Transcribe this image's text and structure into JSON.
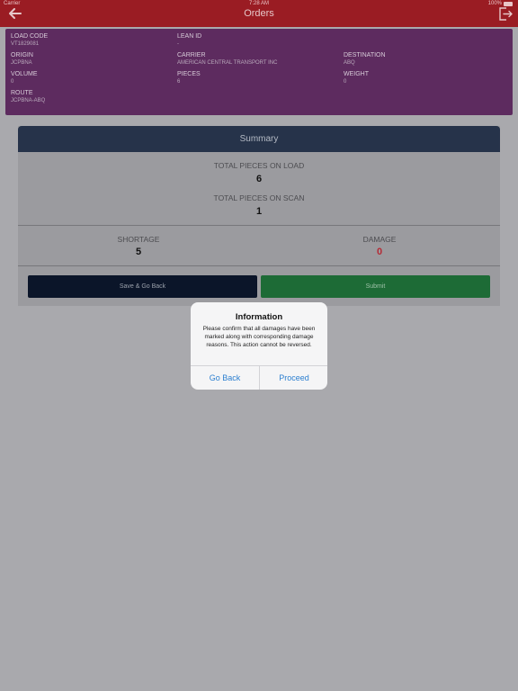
{
  "status_bar": {
    "carrier": "Carrier",
    "time": "7:28 AM",
    "battery": "100%"
  },
  "header": {
    "title": "Orders",
    "back_icon": "arrow-left-icon",
    "logout_icon": "logout-icon"
  },
  "load_info": {
    "load_code_label": "LOAD CODE",
    "load_code": "VT1829081",
    "lean_id_label": "LEAN ID",
    "lean_id": "-",
    "origin_label": "ORIGIN",
    "origin": "JCPBNA",
    "carrier_label": "CARRIER",
    "carrier": "AMERICAN CENTRAL TRANSPORT INC",
    "destination_label": "DESTINATION",
    "destination": "ABQ",
    "volume_label": "VOLUME",
    "volume": "0",
    "pieces_label": "PIECES",
    "pieces": "6",
    "weight_label": "WEIGHT",
    "weight": "0",
    "route_label": "ROUTE",
    "route": "JCPBNA-ABQ"
  },
  "summary": {
    "header": "Summary",
    "total_on_load_label": "TOTAL PIECES ON LOAD",
    "total_on_load": "6",
    "total_on_scan_label": "TOTAL PIECES ON SCAN",
    "total_on_scan": "1",
    "shortage_label": "SHORTAGE",
    "shortage": "5",
    "damage_label": "DAMAGE",
    "damage": "0",
    "save_back_label": "Save & Go Back",
    "submit_label": "Submit"
  },
  "dialog": {
    "title": "Information",
    "message": "Please confirm that all damages have been marked along with corresponding damage reasons. This action cannot be reversed.",
    "go_back_label": "Go Back",
    "proceed_label": "Proceed"
  },
  "colors": {
    "topbar": "#9a1c23",
    "info_card": "#5d2b5f",
    "summary_header": "#26334a",
    "save_button": "#0b1529",
    "submit_button": "#1d6b36",
    "damage_value": "#b52a35",
    "dialog_button": "#2c7fd0"
  }
}
